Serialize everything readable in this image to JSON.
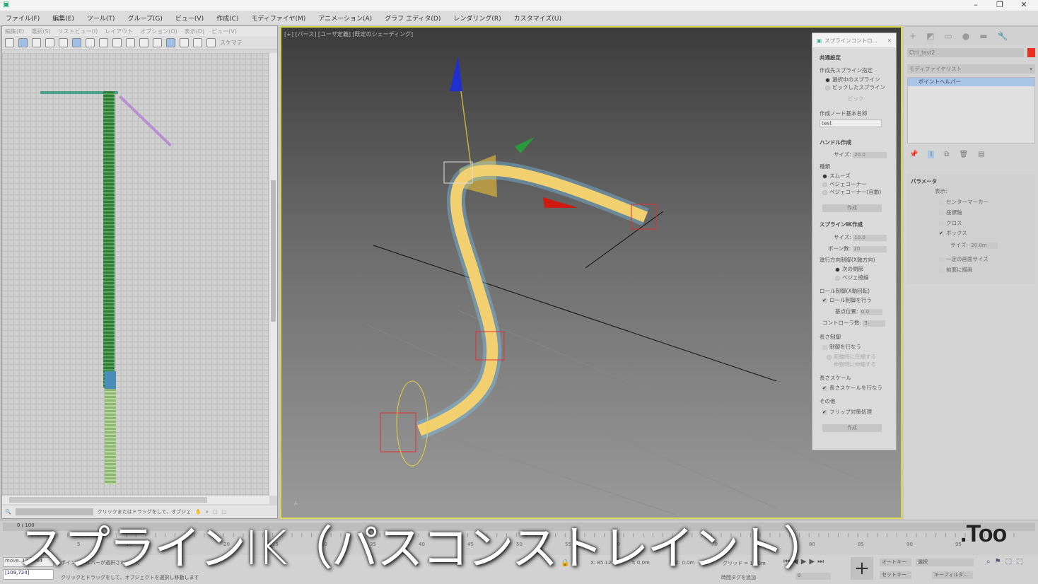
{
  "window": {
    "minimize": "–",
    "maximize": "❐",
    "close": "✕"
  },
  "menu": [
    "ファイル(F)",
    "編集(E)",
    "ツール(T)",
    "グループ(G)",
    "ビュー(V)",
    "作成(C)",
    "モディファイヤ(M)",
    "アニメーション(A)",
    "グラフ エディタ(D)",
    "レンダリング(R)",
    "カスタマイズ(U)"
  ],
  "schematic": {
    "menu": [
      "編集(E)",
      "選択(S)",
      "リストビュー(I)",
      "レイアウト",
      "オプション(O)",
      "表示(D)",
      "ビュー(V)"
    ],
    "toolbar_label": "スケマテ",
    "status_hint": "クリックまたはドラッグをして、オブジェ"
  },
  "viewport": {
    "label": "[+] [パース] [ユーザ定義] [既定のシェーディング]"
  },
  "spline_panel": {
    "title": "スプラインコントロ...",
    "common": "共通設定",
    "target_label": "作成先スプライン指定",
    "target_opts": [
      "選択中のスプライン",
      "ピックしたスプライン"
    ],
    "pick": "ピック",
    "node_name_label": "作成ノード基本名称",
    "node_name": "test",
    "handle": "ハンドル作成",
    "size_label": "サイズ:",
    "handle_size": "20.0",
    "type_label": "種類",
    "type_opts": [
      "スムーズ",
      "ベジェコーナー",
      "ベジェコーナー(自動)"
    ],
    "create": "作成",
    "spline_ik": "スプラインIK作成",
    "ik_size": "10.0",
    "bones_label": "ボーン数:",
    "bones": "20",
    "dir_label": "進行方向制御(X軸方向)",
    "dir_opts": [
      "次の関節",
      "ベジェ接線"
    ],
    "roll_label": "ロール制御(X軸回転)",
    "roll_check": "ロール制御を行う",
    "base_label": "基点位置:",
    "base": "0.0",
    "ctrl_label": "コントローラ数:",
    "ctrl": "3",
    "len_label": "長さ制御",
    "len_check": "制御を行なう",
    "len_opts": [
      "距離時に圧縮する",
      "伸張時に伸縮する"
    ],
    "scale_label": "長さスケール",
    "scale_check": "長さスケールを行なう",
    "other_label": "その他",
    "flip_check": "フリップ対策処理"
  },
  "command_panel": {
    "tabs": [
      "+",
      "◩",
      "▭",
      "●",
      "▬",
      "🔧"
    ],
    "object_name": "Ctrl_test2",
    "object_color": "#e8321e",
    "modifier_list": "モディファイヤリスト",
    "stack_item": "ポイントヘルパー",
    "params_title": "パラメータ",
    "display_label": "表示:",
    "options": [
      {
        "label": "センターマーカー",
        "checked": false
      },
      {
        "label": "座標軸",
        "checked": false
      },
      {
        "label": "クロス",
        "checked": false
      },
      {
        "label": "ボックス",
        "checked": true
      }
    ],
    "size_label": "サイズ:",
    "size": "20.0m",
    "options2": [
      {
        "label": "一定の画面サイズ",
        "checked": false
      },
      {
        "label": "前面に描画",
        "checked": false
      }
    ]
  },
  "timeline": {
    "frame_label": "0 / 100",
    "ticks": [
      "5",
      "10",
      "15",
      "20",
      "25",
      "30",
      "35",
      "40",
      "45",
      "50",
      "55",
      "60",
      "65",
      "70",
      "75",
      "80",
      "85",
      "90",
      "95"
    ]
  },
  "status": {
    "script": "move..12.3544",
    "coords": "[109,724]",
    "msg1": "ポイントヘルパーが選択されました",
    "msg2": "クリックとドラッグをして、オブジェクトを選択し移動します",
    "x": "X: 85.12m",
    "y": "Y: 0.0m",
    "z": "Z: 0.0m",
    "grid": "グリッド = 10.0m",
    "time_tag": "時間タグを追加",
    "frame": "0",
    "auto_key": "オートキー",
    "set_key": "セットキー",
    "selection": "選択",
    "key_filter": "キーフィルタ..."
  },
  "caption": "スプラインIK（パスコンストレイント）",
  "logo": ".Too"
}
